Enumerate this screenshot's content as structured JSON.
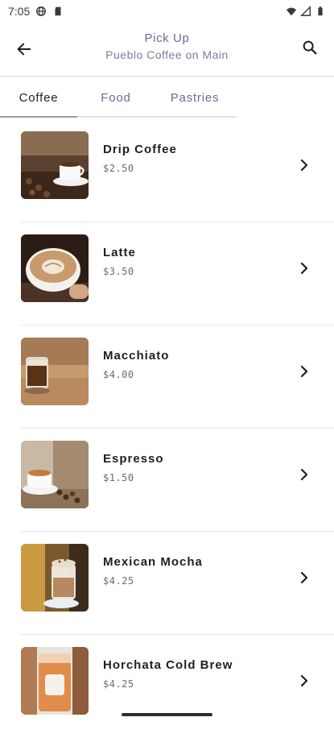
{
  "status_bar": {
    "time": "7:05"
  },
  "header": {
    "title": "Pick Up",
    "subtitle": "Pueblo Coffee on Main"
  },
  "tabs": [
    {
      "label": "Coffee"
    },
    {
      "label": "Food"
    },
    {
      "label": "Pastries"
    }
  ],
  "items": [
    {
      "name": "Drip Coffee",
      "price": "$2.50"
    },
    {
      "name": "Latte",
      "price": "$3.50"
    },
    {
      "name": "Macchiato",
      "price": "$4.00"
    },
    {
      "name": "Espresso",
      "price": "$1.50"
    },
    {
      "name": "Mexican Mocha",
      "price": "$4.25"
    },
    {
      "name": "Horchata Cold Brew",
      "price": "$4.25"
    }
  ],
  "colors": {
    "accent": "#6a6b96",
    "divider": "#e8e8ec"
  },
  "icons": [
    "back-arrow-icon",
    "search-icon",
    "chevron-right-icon"
  ]
}
